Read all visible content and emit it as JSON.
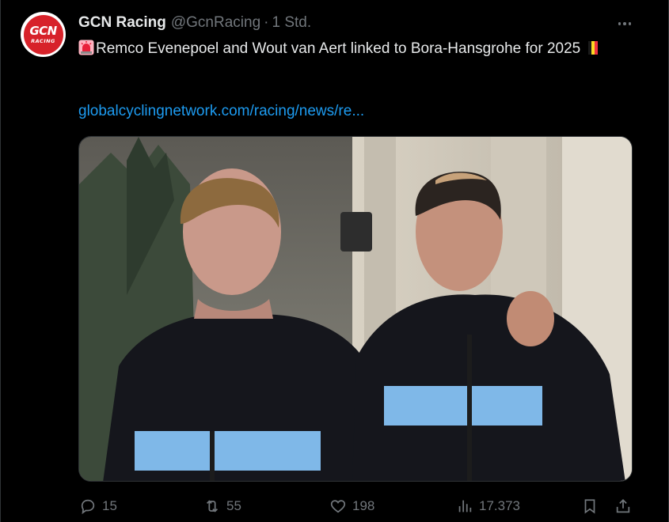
{
  "tweet": {
    "author_name": "GCN Racing",
    "handle": "@GcnRacing",
    "separator": "·",
    "time": "1 Std.",
    "avatar_text_main": "GCN",
    "avatar_text_sub": "RACING",
    "text_line": "Remco Evenepoel and Wout van Aert linked to Bora-Hansgrohe for 2025",
    "link": "globalcyclingnetwork.com/racing/news/re...",
    "image_alt": "Two cyclists in black Belgian Cycling hoodies walking outdoors"
  },
  "actions": {
    "replies": "15",
    "reposts": "55",
    "likes": "198",
    "views": "17.373"
  },
  "colors": {
    "background": "#000000",
    "text": "#e7e9ea",
    "muted": "#71767b",
    "link": "#1d9bf0",
    "brand": "#d7222a"
  },
  "icons": [
    "more-icon",
    "siren-icon",
    "belgium-flag-icon",
    "reply-icon",
    "repost-icon",
    "like-icon",
    "views-icon",
    "bookmark-icon",
    "share-icon"
  ]
}
